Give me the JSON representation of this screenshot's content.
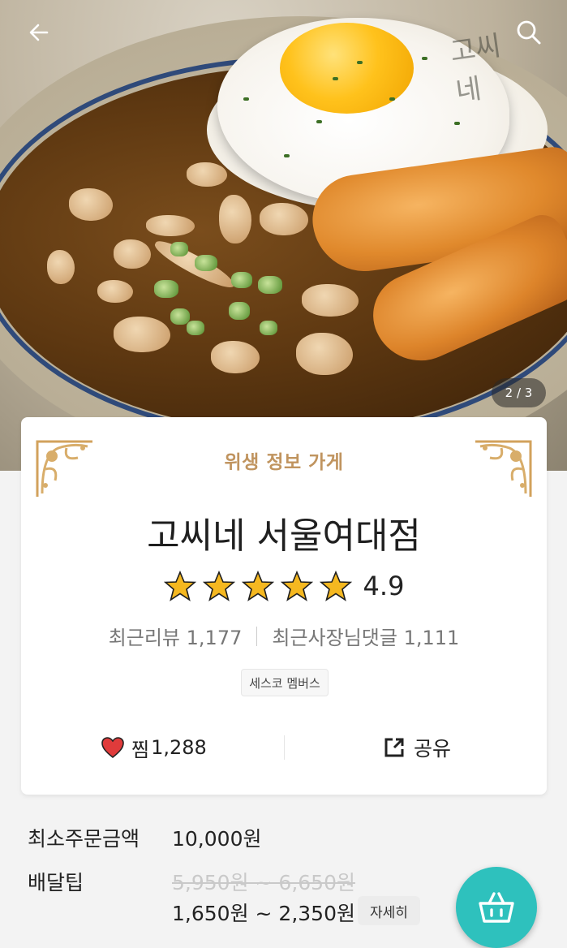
{
  "header": {
    "back_icon": "back-arrow-icon",
    "search_icon": "search-icon",
    "image_pager": "2 / 3",
    "photo_logo": "고씨네"
  },
  "store": {
    "hygiene_label": "위생 정보 가게",
    "name": "고씨네 서울여대점",
    "rating": "4.9",
    "star_count": 5,
    "star_color": "#f5b820",
    "recent_reviews_label": "최근리뷰",
    "recent_reviews_count": "1,177",
    "owner_replies_label": "최근사장님댓글",
    "owner_replies_count": "1,111",
    "member_badge": "세스코 멤버스"
  },
  "actions": {
    "like_label": "찜",
    "like_count": "1,288",
    "like_icon": "heart-icon",
    "share_label": "공유",
    "share_icon": "share-icon"
  },
  "order_info": {
    "min_order_label": "최소주문금액",
    "min_order_value": "10,000원",
    "delivery_tip_label": "배달팁",
    "delivery_tip_old": "5,950원 ~ 6,650원",
    "delivery_tip_new": "1,650원 ~ 2,350원",
    "detail_button": "자세히"
  },
  "cart": {
    "icon": "basket-icon",
    "color": "#2ec1bd"
  },
  "colors": {
    "hygiene_gold": "#c0945f",
    "heart_red": "#e03b3b"
  }
}
